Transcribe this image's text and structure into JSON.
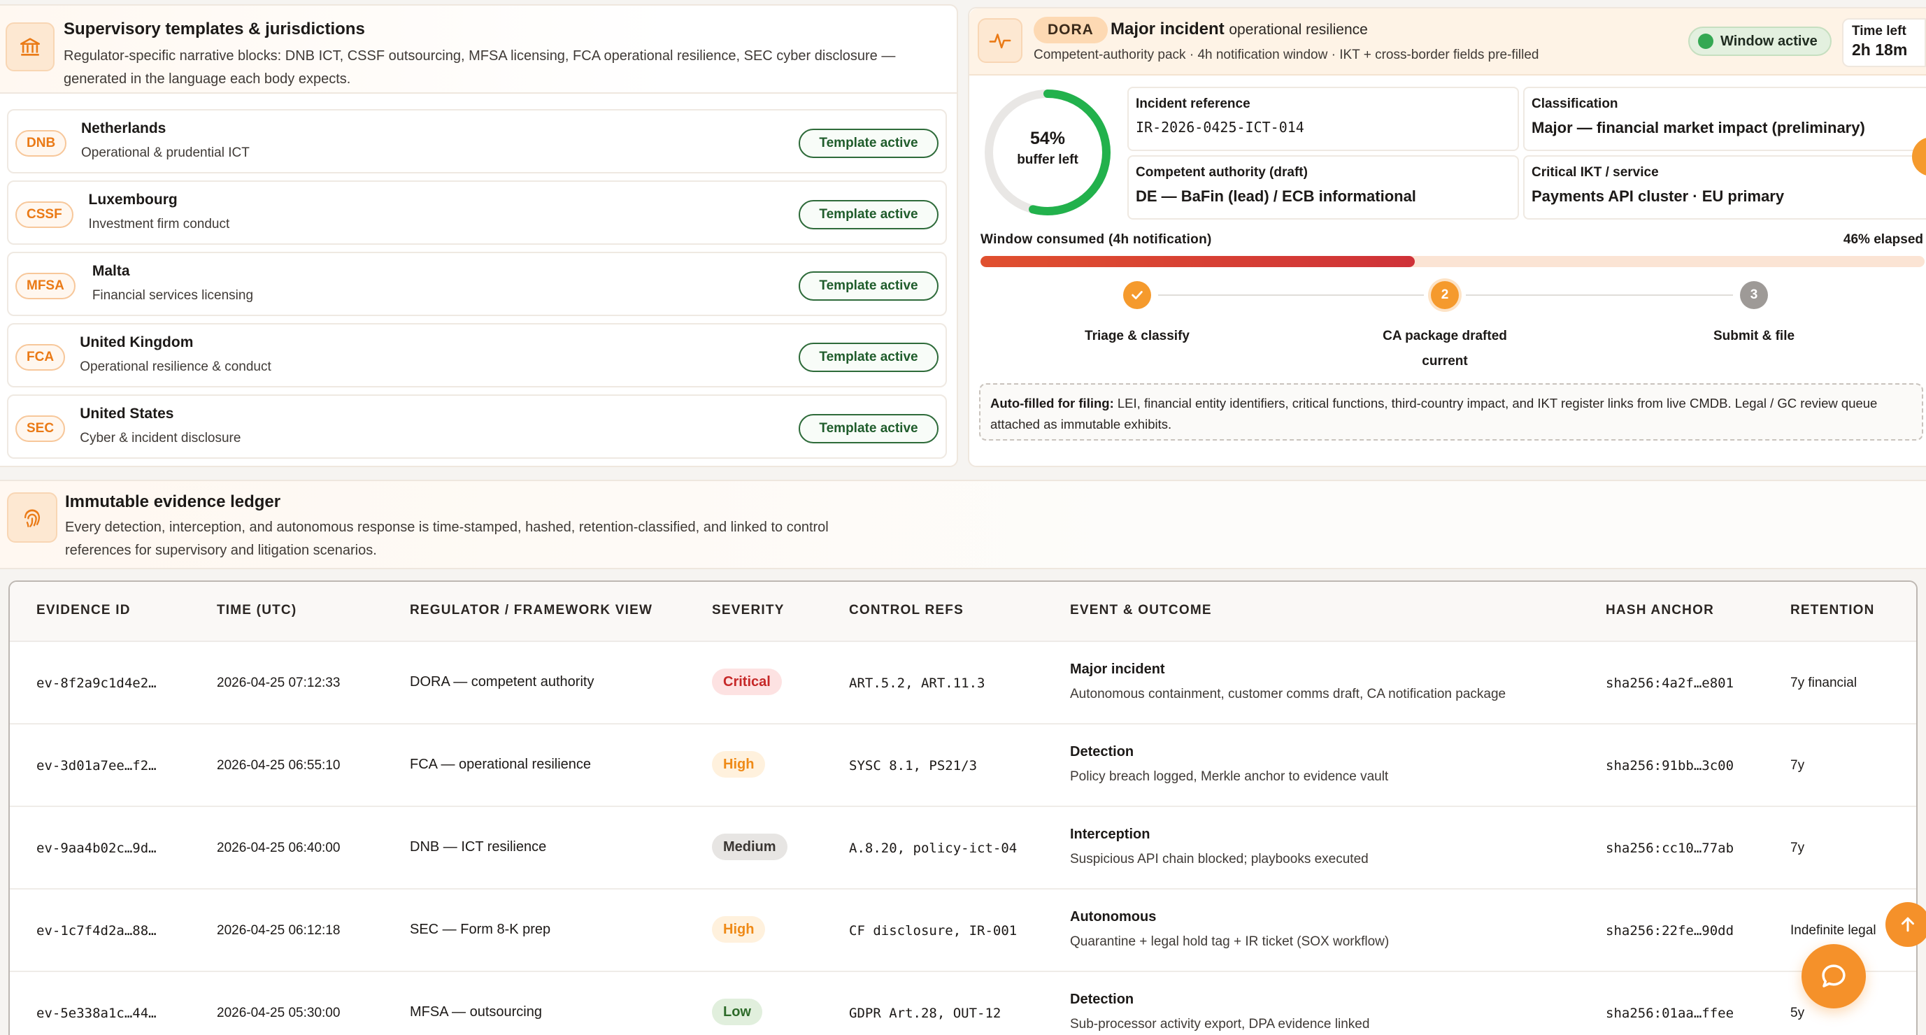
{
  "supervisory": {
    "title": "Supervisory templates & jurisdictions",
    "description": "Regulator-specific narrative blocks: DNB ICT, CSSF outsourcing, MFSA licensing, FCA operational resilience, SEC cyber disclosure — generated in the language each body expects.",
    "icon": "bank-icon",
    "jurisdictions": [
      {
        "code": "DNB",
        "name": "Netherlands",
        "sub": "Operational & prudential ICT",
        "status": "Template active"
      },
      {
        "code": "CSSF",
        "name": "Luxembourg",
        "sub": "Investment firm conduct",
        "status": "Template active"
      },
      {
        "code": "MFSA",
        "name": "Malta",
        "sub": "Financial services licensing",
        "status": "Template active"
      },
      {
        "code": "FCA",
        "name": "United Kingdom",
        "sub": "Operational resilience & conduct",
        "status": "Template active"
      },
      {
        "code": "SEC",
        "name": "United States",
        "sub": "Cyber & incident disclosure",
        "status": "Template active"
      }
    ]
  },
  "dora": {
    "icon": "activity-pulse-icon",
    "badge": "DORA",
    "title_bold": "Major incident",
    "title_rest": "operational resilience",
    "subtitle": "Competent-authority pack · 4h notification window · IKT + cross-border fields pre-filled",
    "window_status": "Window active",
    "time_left_label": "Time left",
    "time_left_value": "2h 18m",
    "buffer_pct_label": "54%",
    "buffer_fraction": 0.54,
    "buffer_label": "buffer left",
    "cards": [
      {
        "label": "Incident reference",
        "value": "IR-2026-0425-ICT-014"
      },
      {
        "label": "Classification",
        "value": "Major — financial market impact (preliminary)"
      },
      {
        "label": "Competent authority (draft)",
        "value": "DE — BaFin (lead) / ECB informational"
      },
      {
        "label": "Critical IKT / service",
        "value": "Payments API cluster · EU primary"
      }
    ],
    "consumed_label": "Window consumed (4h notification)",
    "elapsed_label": "46% elapsed",
    "elapsed_fraction": 0.46,
    "steps": [
      {
        "number": "✓",
        "label": "Triage & classify",
        "state": "done"
      },
      {
        "number": "2",
        "label": "CA package drafted",
        "state": "current"
      },
      {
        "number": "3",
        "label": "Submit & file",
        "state": "pending"
      }
    ],
    "current_label": "current",
    "autofill_bold": "Auto-filled for filing:",
    "autofill_text": "LEI, financial entity identifiers, critical functions, third-country impact, and IKT register links from live CMDB. Legal / GC review queue attached as immutable exhibits.",
    "colors": {
      "accent": "#f59a2d",
      "done": "#f59a2d",
      "pending": "#9e9a97",
      "donut": "#22b14c"
    }
  },
  "ledger": {
    "icon": "fingerprint-icon",
    "title": "Immutable evidence ledger",
    "description": "Every detection, interception, and autonomous response is time-stamped, hashed, retention-classified, and linked to control references for supervisory and litigation scenarios.",
    "columns": [
      "EVIDENCE ID",
      "TIME (UTC)",
      "REGULATOR / FRAMEWORK VIEW",
      "SEVERITY",
      "CONTROL REFS",
      "EVENT & OUTCOME",
      "HASH ANCHOR",
      "RETENTION"
    ],
    "rows": [
      {
        "id": "ev-8f2a9c1d4e2…",
        "time": "2026-04-25 07:12:33",
        "regulator": "DORA — competent authority",
        "severity": "Critical",
        "controls": "ART.5.2, ART.11.3",
        "event": "Major incident",
        "outcome": "Autonomous containment, customer comms draft, CA notification package",
        "hash": "sha256:4a2f…e801",
        "retention": "7y financial"
      },
      {
        "id": "ev-3d01a7ee…f2…",
        "time": "2026-04-25 06:55:10",
        "regulator": "FCA — operational resilience",
        "severity": "High",
        "controls": "SYSC 8.1, PS21/3",
        "event": "Detection",
        "outcome": "Policy breach logged, Merkle anchor to evidence vault",
        "hash": "sha256:91bb…3c00",
        "retention": "7y"
      },
      {
        "id": "ev-9aa4b02c…9d…",
        "time": "2026-04-25 06:40:00",
        "regulator": "DNB — ICT resilience",
        "severity": "Medium",
        "controls": "A.8.20, policy-ict-04",
        "event": "Interception",
        "outcome": "Suspicious API chain blocked; playbooks executed",
        "hash": "sha256:cc10…77ab",
        "retention": "7y"
      },
      {
        "id": "ev-1c7f4d2a…88…",
        "time": "2026-04-25 06:12:18",
        "regulator": "SEC — Form 8-K prep",
        "severity": "High",
        "controls": "CF disclosure, IR-001",
        "event": "Autonomous",
        "outcome": "Quarantine + legal hold tag + IR ticket (SOX workflow)",
        "hash": "sha256:22fe…90dd",
        "retention": "Indefinite legal"
      },
      {
        "id": "ev-5e338a1c…44…",
        "time": "2026-04-25 05:30:00",
        "regulator": "MFSA — outsourcing",
        "severity": "Low",
        "controls": "GDPR Art.28, OUT-12",
        "event": "Detection",
        "outcome": "Sub-processor activity export, DPA evidence linked",
        "hash": "sha256:01aa…ffee",
        "retention": "5y"
      }
    ],
    "severity_colors": {
      "Critical": {
        "bg": "#fde2e2",
        "fg": "#c62828"
      },
      "High": {
        "bg": "#fff1dd",
        "fg": "#ef8a17"
      },
      "Medium": {
        "bg": "#e7e5e3",
        "fg": "#3a3633"
      },
      "Low": {
        "bg": "#e1efdd",
        "fg": "#2e6b2a"
      }
    }
  },
  "fabs": {
    "scroll_up_icon": "arrow-up-icon",
    "chat_icon": "chat-bubble-icon"
  }
}
